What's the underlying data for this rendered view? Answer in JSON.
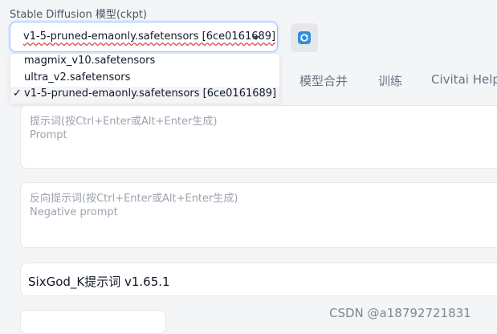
{
  "checkpoint": {
    "label": "Stable Diffusion 模型(ckpt)",
    "selected_value": "v1-5-pruned-emaonly.safetensors [6ce0161689]",
    "options": [
      {
        "label": "magmix_v10.safetensors",
        "checked": false
      },
      {
        "label": "ultra_v2.safetensors",
        "checked": false
      },
      {
        "label": "v1-5-pruned-emaonly.safetensors [6ce0161689]",
        "checked": true
      }
    ],
    "check_mark": "✓",
    "refresh_icon": "refresh-icon"
  },
  "tabs": [
    "模型合并",
    "训练",
    "Civitai Helpe"
  ],
  "prompt": {
    "placeholder_main": "提示词(按Ctrl+Enter或Alt+Enter生成)",
    "placeholder_sub": "Prompt"
  },
  "negative_prompt": {
    "placeholder_main": "反向提示词(按Ctrl+Enter或Alt+Enter生成)",
    "placeholder_sub": "Negative prompt"
  },
  "sixgod": {
    "title": "SixGod_K提示词 v1.65.1"
  },
  "watermark": "CSDN @a18792721831",
  "colors": {
    "accent": "#2f8fe0",
    "focus_border": "#9ec5f5",
    "background": "#f4f5f7"
  }
}
